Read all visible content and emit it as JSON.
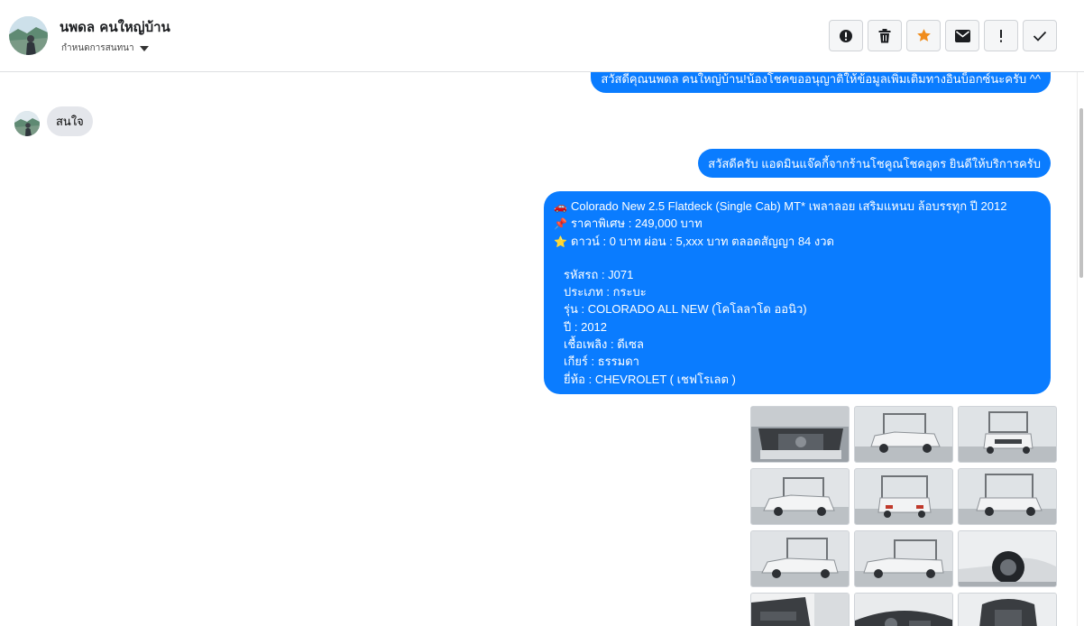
{
  "header": {
    "contact_name": "นพดล คนใหญ่บ้าน",
    "label_picker": "กำหนดการสนทนา",
    "actions": [
      {
        "name": "report-button",
        "icon": "alert-circle-icon"
      },
      {
        "name": "delete-button",
        "icon": "trash-icon"
      },
      {
        "name": "star-button",
        "icon": "star-icon"
      },
      {
        "name": "mark-unread-button",
        "icon": "envelope-icon"
      },
      {
        "name": "important-button",
        "icon": "exclamation-icon"
      },
      {
        "name": "done-button",
        "icon": "check-icon"
      }
    ]
  },
  "messages": {
    "greeting": "สวัสดีคุณนพดล คนใหญ่บ้าน!น้องโชคขออนุญาติให้ข้อมูลเพิ่มเติมทางอินบ็อกซ์นะครับ ^^",
    "incoming": "สนใจ",
    "admin_intro": "สวัสดีครับ แอดมินแจ๊คกี้จากร้านโชคูณโชคอุดร ยินดีให้บริการครับ",
    "car": {
      "emoji_1": "🚗",
      "title": "Colorado New 2.5 Flatdeck (Single Cab) MT* เพลาลอย เสริมแหนบ ล้อบรรทุก  ปี 2012",
      "emoji_2": "📌",
      "price": "ราคาพิเศษ : 249,000 บาท",
      "emoji_3": "⭐",
      "down": "ดาวน์ : 0 บาท ผ่อน : 5,xxx บาท ตลอดสัญญา 84 งวด",
      "code": "รหัสรถ : J071",
      "type": "ประเภท : กระบะ",
      "model": "รุ่น : COLORADO ALL NEW (โคโลลาโด ออนิว)",
      "year": "ปี : 2012",
      "fuel": "เชื้อเพลิง : ดีเซล",
      "gear": "เกียร์ : ธรรมดา",
      "brand": "ยี่ห้อ : CHEVROLET ( เชฟโรเลต )"
    }
  },
  "colors": {
    "outgoing_bubble": "#0a7cff",
    "incoming_bubble": "#e4e6eb",
    "star_active": "#f08c1c"
  },
  "gallery": {
    "photos": [
      {
        "id": "engine-bay"
      },
      {
        "id": "front-left"
      },
      {
        "id": "front"
      },
      {
        "id": "front-left-2"
      },
      {
        "id": "rear"
      },
      {
        "id": "rear-right"
      },
      {
        "id": "left-side"
      },
      {
        "id": "left-profile"
      },
      {
        "id": "wheel-closeup"
      },
      {
        "id": "interior-door"
      },
      {
        "id": "interior-dash"
      },
      {
        "id": "interior-seat"
      }
    ]
  }
}
